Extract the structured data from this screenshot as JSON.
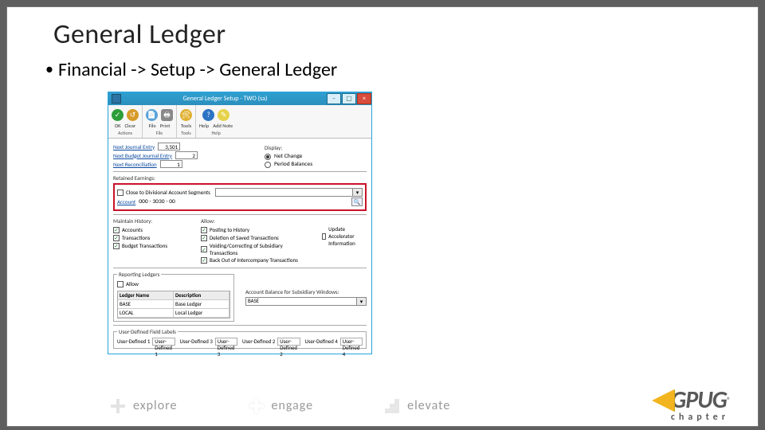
{
  "slide": {
    "title": "General Ledger",
    "bullet": "Financial -> Setup -> General Ledger"
  },
  "window": {
    "title": "General Ledger Setup  -  TWO (sa)",
    "ribbon": {
      "actions_group": "Actions",
      "ok": "OK",
      "clear": "Clear",
      "file_group": "File",
      "file": "File",
      "print": "Print",
      "tools_group": "Tools",
      "tools": "Tools",
      "help_group": "Help",
      "help": "Help",
      "add_note": "Add Note"
    },
    "links": {
      "next_journal": "Next Journal Entry",
      "next_budget": "Next Budget Journal Entry",
      "next_recon": "Next Reconciliation"
    },
    "vals": {
      "a": "3,501",
      "b": "2",
      "c": "1"
    },
    "display": {
      "legend": "Display:",
      "net": "Net Change",
      "period": "Period Balances"
    },
    "retained": {
      "legend": "Retained Earnings:",
      "close_chk": "Close to Divisional Account Segments",
      "account_link": "Account",
      "account_val": "000 - 3030 - 00"
    },
    "maintain": {
      "legend": "Maintain History:",
      "accounts": "Accounts",
      "transactions": "Transactions",
      "budget": "Budget Transactions"
    },
    "allow": {
      "legend": "Allow:",
      "posting": "Posting to History",
      "deletion": "Deletion of Saved Transactions",
      "voiding": "Voiding/Correcting of Subsidiary Transactions",
      "backout": "Back Out of Intercompany Transactions"
    },
    "update_accel": "Update Accelerator Information",
    "reporting": {
      "legend": "Reporting Ledgers",
      "allow": "Allow",
      "col_name": "Ledger Name",
      "col_desc": "Description",
      "r1n": "BASE",
      "r1d": "Base Ledger",
      "r2n": "LOCAL",
      "r2d": "Local Ledger"
    },
    "acct_bal": {
      "legend": "Account Balance for Subsidiary Windows:",
      "val": "BASE"
    },
    "udf": {
      "legend": "User-Defined Field Labels",
      "l1": "User-Defined 1",
      "v1": "User-Defined 1",
      "l2": "User-Defined 2",
      "v2": "User-Defined 2",
      "l3": "User-Defined 3",
      "v3": "User-Defined 3",
      "l4": "User-Defined 4",
      "v4": "User-Defined 4"
    }
  },
  "footer": {
    "a": "explore",
    "b": "engage",
    "c": "elevate"
  },
  "brand": {
    "name": "GPUG",
    "sub": "chapter"
  }
}
